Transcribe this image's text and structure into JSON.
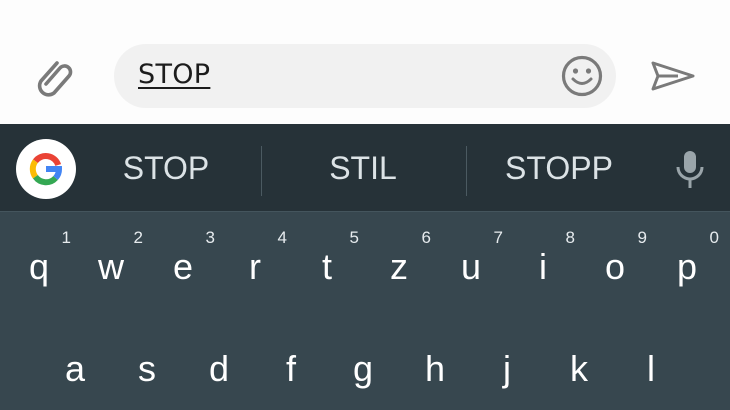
{
  "compose": {
    "input_value": "STOP",
    "icons": {
      "attach": "paperclip-icon",
      "emoji": "smiley-icon",
      "send": "send-icon"
    }
  },
  "keyboard": {
    "suggestions": [
      "STOP",
      "STIL",
      "STOPP"
    ],
    "icons": {
      "logo": "google-g-icon",
      "mic": "microphone-icon"
    },
    "row1": [
      {
        "char": "q",
        "hint": "1"
      },
      {
        "char": "w",
        "hint": "2"
      },
      {
        "char": "e",
        "hint": "3"
      },
      {
        "char": "r",
        "hint": "4"
      },
      {
        "char": "t",
        "hint": "5"
      },
      {
        "char": "z",
        "hint": "6"
      },
      {
        "char": "u",
        "hint": "7"
      },
      {
        "char": "i",
        "hint": "8"
      },
      {
        "char": "o",
        "hint": "9"
      },
      {
        "char": "p",
        "hint": "0"
      }
    ],
    "row2": [
      "a",
      "s",
      "d",
      "f",
      "g",
      "h",
      "j",
      "k",
      "l"
    ]
  },
  "colors": {
    "keyboard_bg": "#37474f",
    "suggestion_bar_bg": "#263238",
    "input_pill_bg": "#f1f1f1",
    "icon_grey": "#7a7a7a"
  }
}
